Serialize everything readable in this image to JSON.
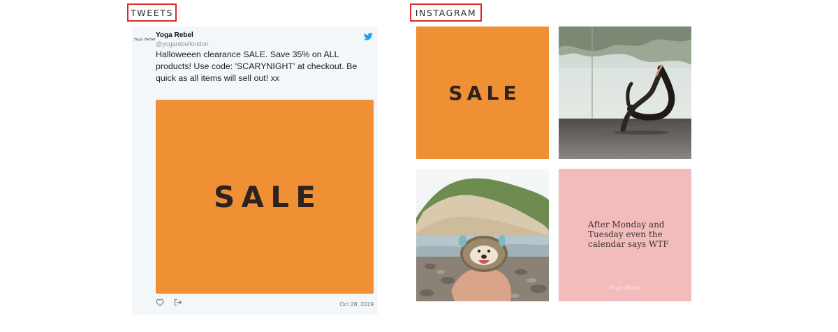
{
  "sections": {
    "tweets_heading": "TWEETS",
    "instagram_heading": "INSTAGRAM"
  },
  "tweet": {
    "avatar_text": "Yoga Rebel",
    "author_name": "Yoga Rebel",
    "author_handle": "@yogarebellondon",
    "text": "Halloweeen clearance SALE. Save 35% on ALL products! Use code: 'SCARYNIGHT' at checkout. Be quick as all items will sell out! xx",
    "media_text": "SALE",
    "date": "Oct 28, 2019",
    "icons": [
      "twitter-bird-icon",
      "heart-icon",
      "share-icon"
    ]
  },
  "instagram": {
    "tiles": [
      {
        "type": "graphic",
        "text": "SALE",
        "color": "#ef9035"
      },
      {
        "type": "photo",
        "subject": "yoga-pose-photo"
      },
      {
        "type": "photo",
        "subject": "hedgehog-beach-photo"
      },
      {
        "type": "graphic",
        "text": "After Monday and Tuesday even the calendar says WTF",
        "signature": "Yoga Rebel",
        "color": "#f2bcbc"
      }
    ]
  },
  "colors": {
    "accent_orange": "#ef9035",
    "heading_border": "#d62b2b",
    "twitter_blue": "#1da1f2",
    "pink_tile": "#f2bcbc"
  }
}
